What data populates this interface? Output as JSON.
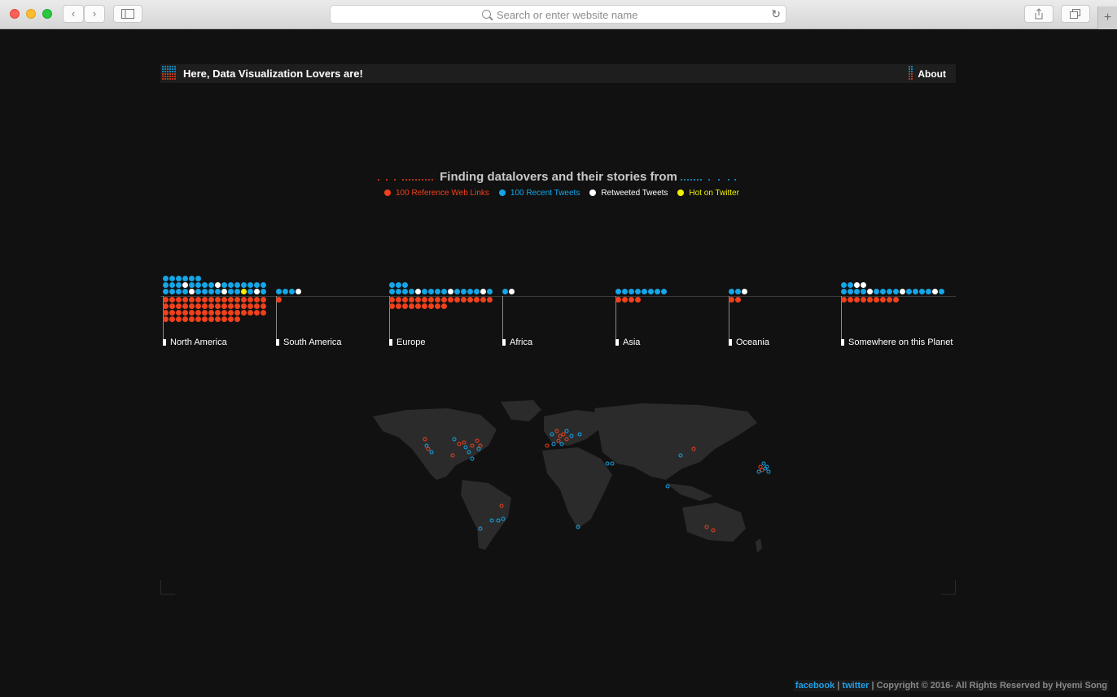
{
  "browser": {
    "address_placeholder": "Search or enter website name"
  },
  "nav": {
    "brand": "Here, Data Visualization Lovers are!",
    "about": "About"
  },
  "headline": "Finding datalovers and their stories from",
  "legend": [
    {
      "label": "100 Reference Web Links",
      "color": "#f0401c"
    },
    {
      "label": "100 Recent Tweets",
      "color": "#14a6e8"
    },
    {
      "label": "Retweeted Tweets",
      "color": "#ffffff"
    },
    {
      "label": "Hot on Twitter",
      "color": "#f0f000"
    }
  ],
  "continents": [
    {
      "name": "North America",
      "tweets": 38,
      "retweets": 5,
      "hot": 1,
      "links": 60
    },
    {
      "name": "South America",
      "tweets": 4,
      "retweets": 1,
      "hot": 0,
      "links": 1
    },
    {
      "name": "Europe",
      "tweets": 19,
      "retweets": 3,
      "hot": 0,
      "links": 25
    },
    {
      "name": "Africa",
      "tweets": 2,
      "retweets": 1,
      "hot": 0,
      "links": 0
    },
    {
      "name": "Asia",
      "tweets": 8,
      "retweets": 0,
      "hot": 0,
      "links": 4
    },
    {
      "name": "Oceania",
      "tweets": 3,
      "retweets": 1,
      "hot": 0,
      "links": 2
    },
    {
      "name": "Somewhere on this Planet",
      "tweets": 20,
      "retweets": 5,
      "hot": 0,
      "links": 9
    }
  ],
  "footer": {
    "facebook": "facebook",
    "twitter": "twitter",
    "copyright": "Copyright © 2016- All Rights Reserved by Hyemi Song"
  }
}
